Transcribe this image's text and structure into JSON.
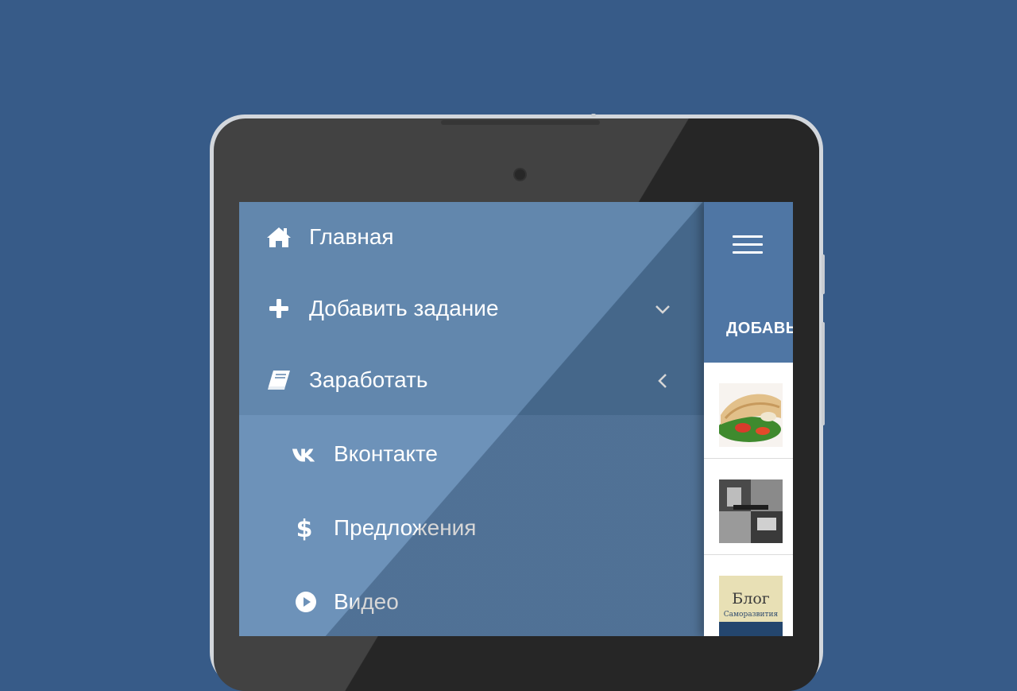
{
  "drawer": {
    "items": [
      {
        "label": "Главная",
        "icon": "home-icon"
      },
      {
        "label": "Добавить задание",
        "icon": "plus-icon",
        "chevron": "chevron-down-icon"
      },
      {
        "label": "Заработать",
        "icon": "book-icon",
        "chevron": "chevron-left-icon"
      }
    ],
    "subitems": [
      {
        "label": "Вконтакте",
        "icon": "vk-icon"
      },
      {
        "label": "Предложения",
        "icon": "dollar-icon"
      },
      {
        "label": "Видео",
        "icon": "play-circle-icon"
      }
    ]
  },
  "app": {
    "menu_icon": "hamburger-menu-icon",
    "tab_label": "ДОБАВЬ",
    "list_items": [
      {
        "thumb_text": ""
      },
      {
        "thumb_text": ""
      },
      {
        "thumb_title": "Блог",
        "thumb_subtitle": "Саморазвития"
      }
    ]
  },
  "colors": {
    "background": "#375b88",
    "drawer": "#527ba5",
    "drawer_sub": "#5f87b2",
    "appbar": "#4f76a4"
  }
}
